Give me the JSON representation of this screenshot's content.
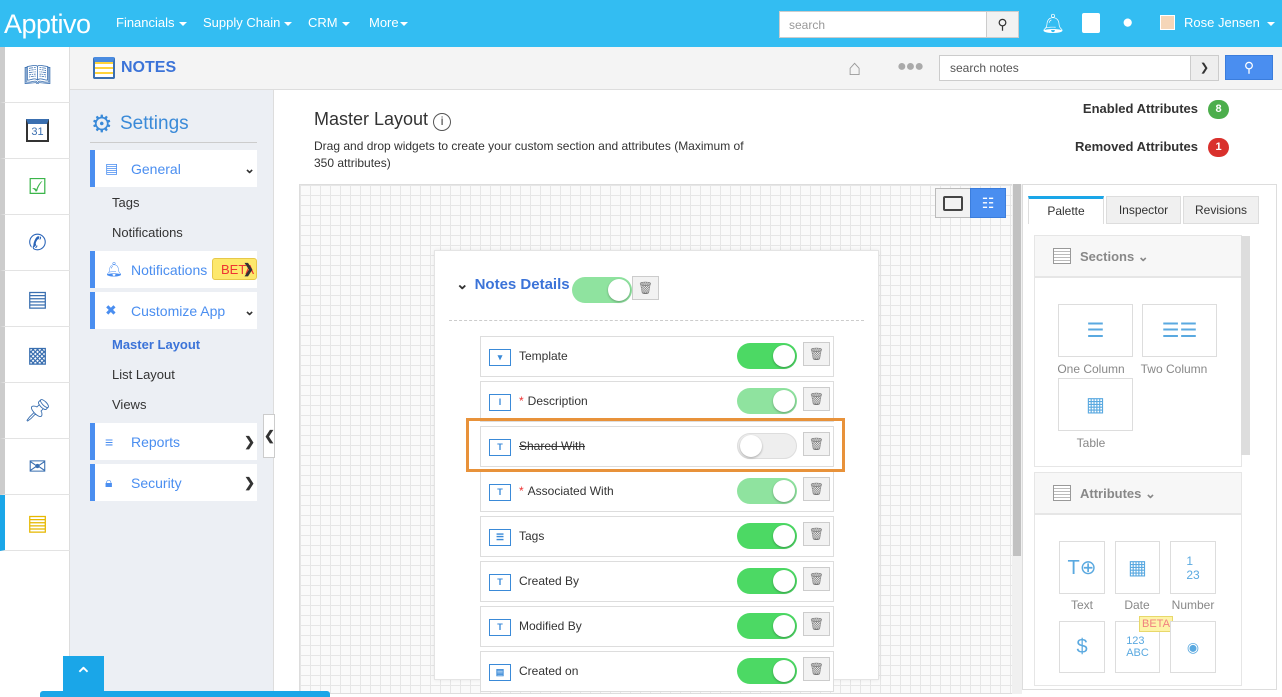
{
  "topbar": {
    "logo": "Apptivo",
    "nav": [
      "Financials",
      "Supply Chain",
      "CRM",
      "More"
    ],
    "search_placeholder": "search",
    "user": "Rose Jensen"
  },
  "rail": {
    "icons": [
      "book-icon",
      "calendar-icon",
      "tasks-icon",
      "phone-icon",
      "forms-icon",
      "contacts-icon",
      "pin-icon",
      "mail-icon",
      "notes-icon"
    ],
    "calendar_day": "31"
  },
  "subheader": {
    "title": "NOTES",
    "search_placeholder": "search notes"
  },
  "sidebar": {
    "title": "Settings",
    "general": "General",
    "general_items": [
      "Tags",
      "Notifications"
    ],
    "notifications": "Notifications",
    "beta": "BETA",
    "customize": "Customize App",
    "customize_items": [
      "Master Layout",
      "List Layout",
      "Views"
    ],
    "reports": "Reports",
    "security": "Security"
  },
  "main": {
    "title": "Master Layout",
    "description": "Drag and drop widgets to create your custom section and attributes (Maximum of 350 attributes)",
    "enabled_label": "Enabled Attributes",
    "enabled_count": "8",
    "removed_label": "Removed Attributes",
    "removed_count": "1",
    "section": {
      "title": "Notes Details",
      "enabled": true
    },
    "rows": [
      {
        "label": "Template",
        "required": false,
        "state": "on"
      },
      {
        "label": "Description",
        "required": true,
        "state": "locked"
      },
      {
        "label": "Shared With",
        "required": false,
        "state": "off"
      },
      {
        "label": "Associated With",
        "required": true,
        "state": "locked"
      },
      {
        "label": "Tags",
        "required": false,
        "state": "on"
      },
      {
        "label": "Created By",
        "required": false,
        "state": "on"
      },
      {
        "label": "Modified By",
        "required": false,
        "state": "on"
      },
      {
        "label": "Created on",
        "required": false,
        "state": "on"
      }
    ]
  },
  "panel": {
    "tabs": [
      "Palette",
      "Inspector",
      "Revisions"
    ],
    "sections_label": "Sections",
    "section_tiles": [
      "One Column",
      "Two Column",
      "Table"
    ],
    "attributes_label": "Attributes",
    "attribute_tiles": [
      "Text",
      "Date",
      "Number"
    ],
    "beta": "BETA",
    "colors": {
      "accent": "#1aa6e8",
      "highlight": "#e8923a",
      "toggle_on": "#4cd964"
    }
  }
}
